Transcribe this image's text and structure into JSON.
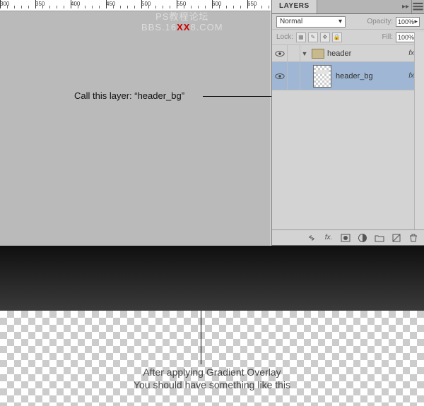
{
  "ruler": {
    "marks": [
      300,
      350,
      400,
      450,
      500,
      550,
      600,
      650
    ]
  },
  "watermark": {
    "line1": "PS教程论坛",
    "prefix": "BBS.16",
    "xx": "XX",
    "suffix": "8.COM"
  },
  "callout": {
    "text": "Call this layer: “header_bg”"
  },
  "panel": {
    "tab": "LAYERS",
    "blend_mode": "Normal",
    "opacity_label": "Opacity:",
    "opacity_value": "100%",
    "lock_label": "Lock:",
    "fill_label": "Fill:",
    "fill_value": "100%",
    "group": {
      "name": "header",
      "fx": "fx"
    },
    "layer": {
      "name": "header_bg",
      "fx": "fx"
    }
  },
  "footer_icons": [
    "link",
    "fx",
    "mask",
    "adjust",
    "group",
    "new",
    "trash"
  ],
  "bottom": {
    "line1": "After applying Gradient Overlay",
    "line2": "You should have something like this"
  }
}
